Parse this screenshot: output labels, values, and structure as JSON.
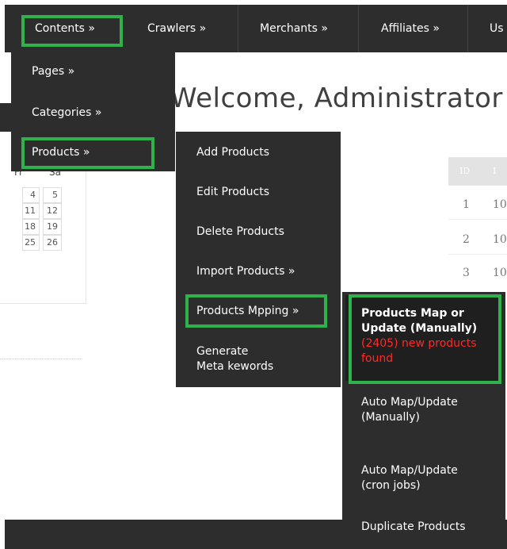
{
  "nav": {
    "contents": "Contents »",
    "crawlers": "Crawlers »",
    "merchants": "Merchants »",
    "affiliates": "Affiliates »",
    "users_partial": "Us"
  },
  "contents_menu": {
    "pages": "Pages »",
    "categories": "Categories »",
    "products": "Products »"
  },
  "products_menu": {
    "add": "Add Products",
    "edit": "Edit Products",
    "delete": "Delete Products",
    "import": "Import Products »",
    "mapping": "Products Mpping »",
    "meta": "Generate\nMeta kewords"
  },
  "mapping_menu": {
    "map_update_manual": "Products Map or Update (Manually)",
    "new_products_notice": "(2405) new products found",
    "auto_map_manual": "Auto Map/Update (Manually)",
    "auto_map_cron": "Auto Map/Update (cron jobs)",
    "duplicate": "Duplicate Products"
  },
  "main": {
    "welcome": "Welcome, Administrator!"
  },
  "calendar": {
    "headers": [
      "Fr",
      "Sa"
    ],
    "rows": [
      [
        "4",
        "5"
      ],
      [
        "11",
        "12"
      ],
      [
        "18",
        "19"
      ],
      [
        "25",
        "26"
      ]
    ]
  },
  "id_table": {
    "header_id": "ID",
    "header_next": "I",
    "rows": [
      {
        "id": "1",
        "next": "10"
      },
      {
        "id": "2",
        "next": "10"
      },
      {
        "id": "3",
        "next": "10"
      }
    ]
  },
  "colors": {
    "nav_bg": "#2d2d2d",
    "highlight": "#2fb24b",
    "alert": "#ff2a2a",
    "active_bg": "#1f1f1f"
  }
}
